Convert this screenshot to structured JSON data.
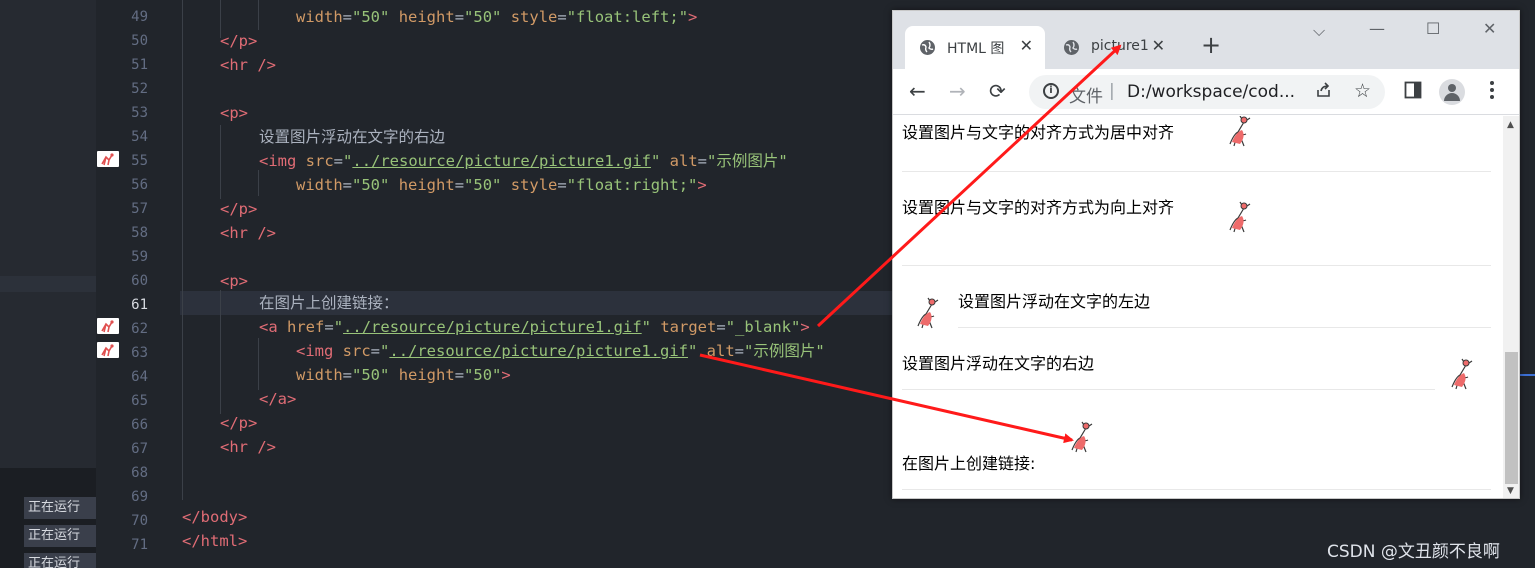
{
  "status_panel": {
    "run_badges": [
      "正在运行",
      "正在运行",
      "正在运行"
    ]
  },
  "editor": {
    "current_line": 61,
    "line_numbers": [
      "49",
      "50",
      "51",
      "52",
      "53",
      "54",
      "55",
      "56",
      "57",
      "58",
      "59",
      "60",
      "61",
      "62",
      "63",
      "64",
      "65",
      "66",
      "67",
      "68",
      "69",
      "70",
      "71"
    ],
    "code": {
      "l49": {
        "a1": "width",
        "v1": "\"50\"",
        "a2": "height",
        "v2": "\"50\"",
        "a3": "style",
        "v3": "\"float:left;\""
      },
      "l50": "</p>",
      "l51": "<hr />",
      "l53": "<p>",
      "l54": "设置图片浮动在文字的右边",
      "l55": {
        "tag": "<img",
        "a1": "src",
        "v1": "../resource/picture/picture1.gif",
        "a2": "alt",
        "v2": "\"示例图片\""
      },
      "l56": {
        "a1": "width",
        "v1": "\"50\"",
        "a2": "height",
        "v2": "\"50\"",
        "a3": "style",
        "v3": "\"float:right;\""
      },
      "l57": "</p>",
      "l58": "<hr />",
      "l60": "<p>",
      "l61": "在图片上创建链接：",
      "l62": {
        "tag": "<a",
        "a1": "href",
        "v1": "../resource/picture/picture1.gif",
        "a2": "target",
        "v2": "\"_blank\""
      },
      "l63": {
        "tag": "<img",
        "a1": "src",
        "v1": "../resource/picture/picture1.gif",
        "a2": "alt",
        "v2": "\"示例图片\""
      },
      "l64": {
        "a1": "width",
        "v1": "\"50\"",
        "a2": "height",
        "v2": "\"50\""
      },
      "l65": "</a>",
      "l66": "</p>",
      "l67": "<hr />",
      "l70": "</body>",
      "l71": "</html>"
    }
  },
  "browser": {
    "tabs": [
      {
        "title": "HTML 图",
        "close": "✕"
      },
      {
        "title": "picture1",
        "close": "✕"
      }
    ],
    "new_tab": "+",
    "window_controls": {
      "dropdown": "⌵",
      "minimize": "—",
      "maximize": "☐",
      "close": "✕"
    },
    "nav": {
      "back": "←",
      "forward": "→",
      "reload": "⟳"
    },
    "address": {
      "scheme_label": "文件",
      "separator": "|",
      "url": "D:/workspace/cod..."
    },
    "page": {
      "line1": "设置图片与文字的对齐方式为居中对齐",
      "line2": "设置图片与文字的对齐方式为向上对齐",
      "line3": "设置图片浮动在文字的左边",
      "line4": "设置图片浮动在文字的右边",
      "line5": "在图片上创建链接:"
    }
  },
  "watermark": "CSDN @文丑颜不良啊",
  "colors": {
    "tag": "#e06c75",
    "attr": "#d19a66",
    "string": "#98c379",
    "arrow": "#ff1a1a"
  }
}
